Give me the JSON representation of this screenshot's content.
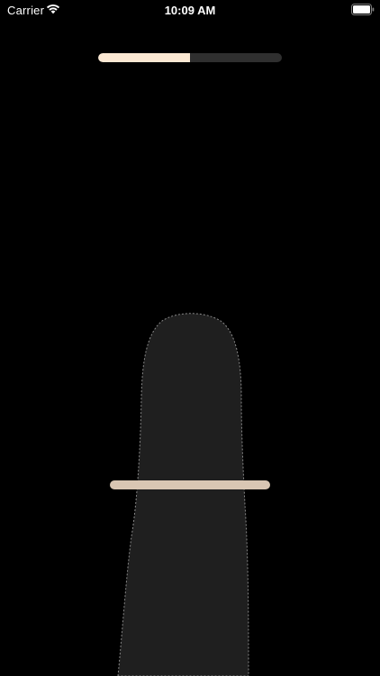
{
  "status_bar": {
    "carrier": "Carrier",
    "time": "10:09 AM",
    "icons": [
      "wifi-icon",
      "battery-icon"
    ]
  },
  "progress": {
    "fraction": 0.5,
    "fill_color": "#fbe8d3",
    "track_color": "#2f2f2f"
  },
  "finger": {
    "fill_color": "#1f1f1f",
    "outline_color": "#8a8a8a"
  },
  "ring_marker": {
    "color": "#d9c6b3"
  }
}
